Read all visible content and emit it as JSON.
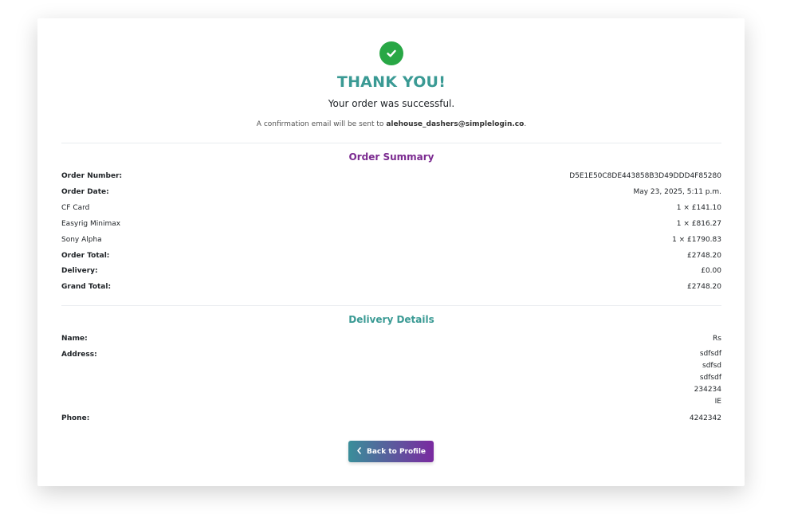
{
  "header": {
    "title": "THANK YOU!",
    "subtitle": "Your order was successful.",
    "confirm_prefix": "A confirmation email will be sent to ",
    "confirm_email": "alehouse_dashers@simplelogin.co",
    "confirm_suffix": "."
  },
  "order_summary": {
    "title": "Order Summary",
    "order_number_label": "Order Number:",
    "order_number": "D5E1E50C8DE443858B3D49DDD4F85280",
    "order_date_label": "Order Date:",
    "order_date": "May 23, 2025, 5:11 p.m.",
    "items": [
      {
        "name": "CF Card",
        "qty_price": "1 × £141.10"
      },
      {
        "name": "Easyrig Minimax",
        "qty_price": "1 × £816.27"
      },
      {
        "name": "Sony Alpha",
        "qty_price": "1 × £1790.83"
      }
    ],
    "order_total_label": "Order Total:",
    "order_total": "£2748.20",
    "delivery_label": "Delivery:",
    "delivery": "£0.00",
    "grand_total_label": "Grand Total:",
    "grand_total": "£2748.20"
  },
  "delivery_details": {
    "title": "Delivery Details",
    "name_label": "Name:",
    "name": "Rs",
    "address_label": "Address:",
    "address_lines": [
      "sdfsdf",
      "sdfsd",
      "sdfsdf",
      "234234",
      "IE"
    ],
    "phone_label": "Phone:",
    "phone": "4242342"
  },
  "actions": {
    "back_label": "Back to Profile"
  },
  "icons": {
    "success": "check-circle-icon",
    "back": "chevron-left-icon"
  },
  "colors": {
    "success": "#28a745",
    "accent_teal": "#3a9a94",
    "accent_purple": "#7b2a90"
  }
}
